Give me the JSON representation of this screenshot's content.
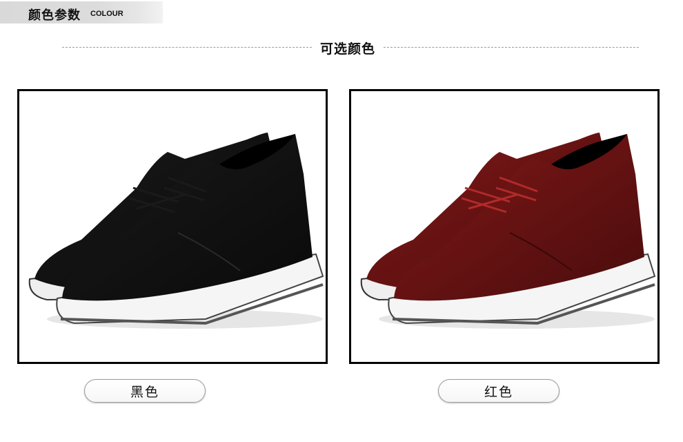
{
  "header": {
    "title_zh": "颜色参数",
    "title_en": "COLOUR"
  },
  "section_title": "可选颜色",
  "variants": [
    {
      "label": "黑色",
      "shoe_color": "#141414",
      "shoe_highlight": "#4a4a4a"
    },
    {
      "label": "红色",
      "shoe_color": "#6e1414",
      "shoe_highlight": "#a83a3a"
    }
  ]
}
